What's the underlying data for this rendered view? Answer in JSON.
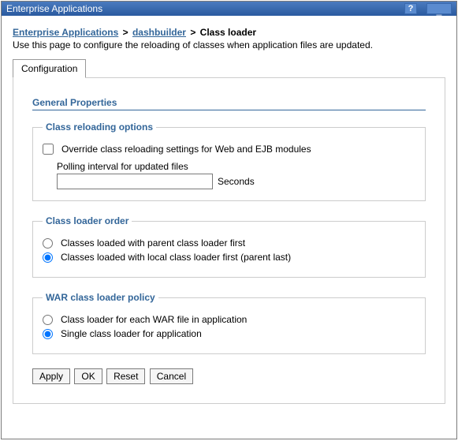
{
  "window": {
    "title": "Enterprise Applications",
    "help_symbol": "?",
    "min_symbol": "_"
  },
  "breadcrumb": {
    "link1": "Enterprise Applications",
    "link2": "dashbuilder",
    "current": "Class loader",
    "sep": ">"
  },
  "description": "Use this page to configure the reloading of classes when application files are updated.",
  "tab": {
    "label": "Configuration"
  },
  "section": {
    "title": "General Properties"
  },
  "fs1": {
    "legend": "Class reloading options",
    "override_label": "Override class reloading settings for Web and EJB modules",
    "polling_label": "Polling interval for updated files",
    "polling_value": "",
    "unit": "Seconds"
  },
  "fs2": {
    "legend": "Class loader order",
    "opt1": "Classes loaded with parent class loader first",
    "opt2": "Classes loaded with local class loader first (parent last)"
  },
  "fs3": {
    "legend": "WAR class loader policy",
    "opt1": "Class loader for each WAR file in application",
    "opt2": "Single class loader for application"
  },
  "buttons": {
    "apply": "Apply",
    "ok": "OK",
    "reset": "Reset",
    "cancel": "Cancel"
  }
}
